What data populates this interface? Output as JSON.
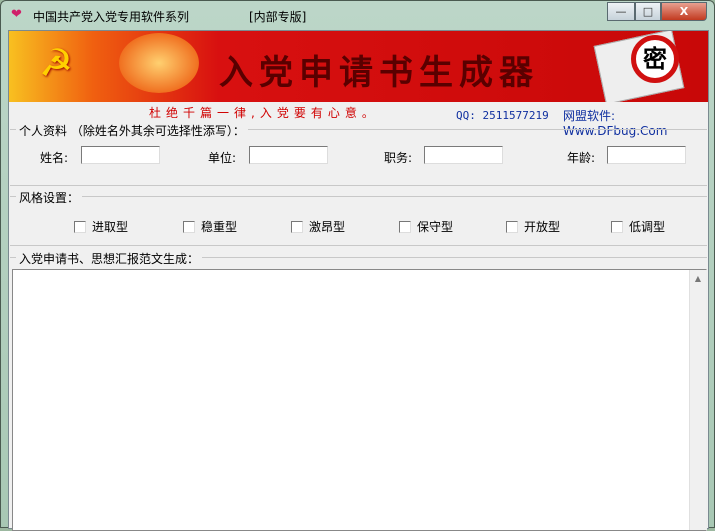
{
  "window": {
    "title": "中国共产党入党专用软件系列",
    "edition": "[内部专版]",
    "minimize": "—",
    "maximize": "□",
    "close": "X"
  },
  "banner": {
    "title": "入党申请书生成器",
    "seal": "密"
  },
  "tagline": "杜绝千篇一律,入党要有心意。",
  "qq": "QQ: 2511577219",
  "site": "网盟软件: Www.DFbug.Com",
  "personal": {
    "legend": "个人资料 （除姓名外其余可选择性添写）：",
    "fields": [
      {
        "label": "姓名:",
        "value": ""
      },
      {
        "label": "单位:",
        "value": ""
      },
      {
        "label": "职务:",
        "value": ""
      },
      {
        "label": "年龄:",
        "value": ""
      }
    ]
  },
  "style": {
    "legend": "风格设置：",
    "options": [
      "进取型",
      "稳重型",
      "激昂型",
      "保守型",
      "开放型",
      "低调型"
    ]
  },
  "output": {
    "legend": "入党申请书、思想汇报范文生成：",
    "text": ""
  }
}
